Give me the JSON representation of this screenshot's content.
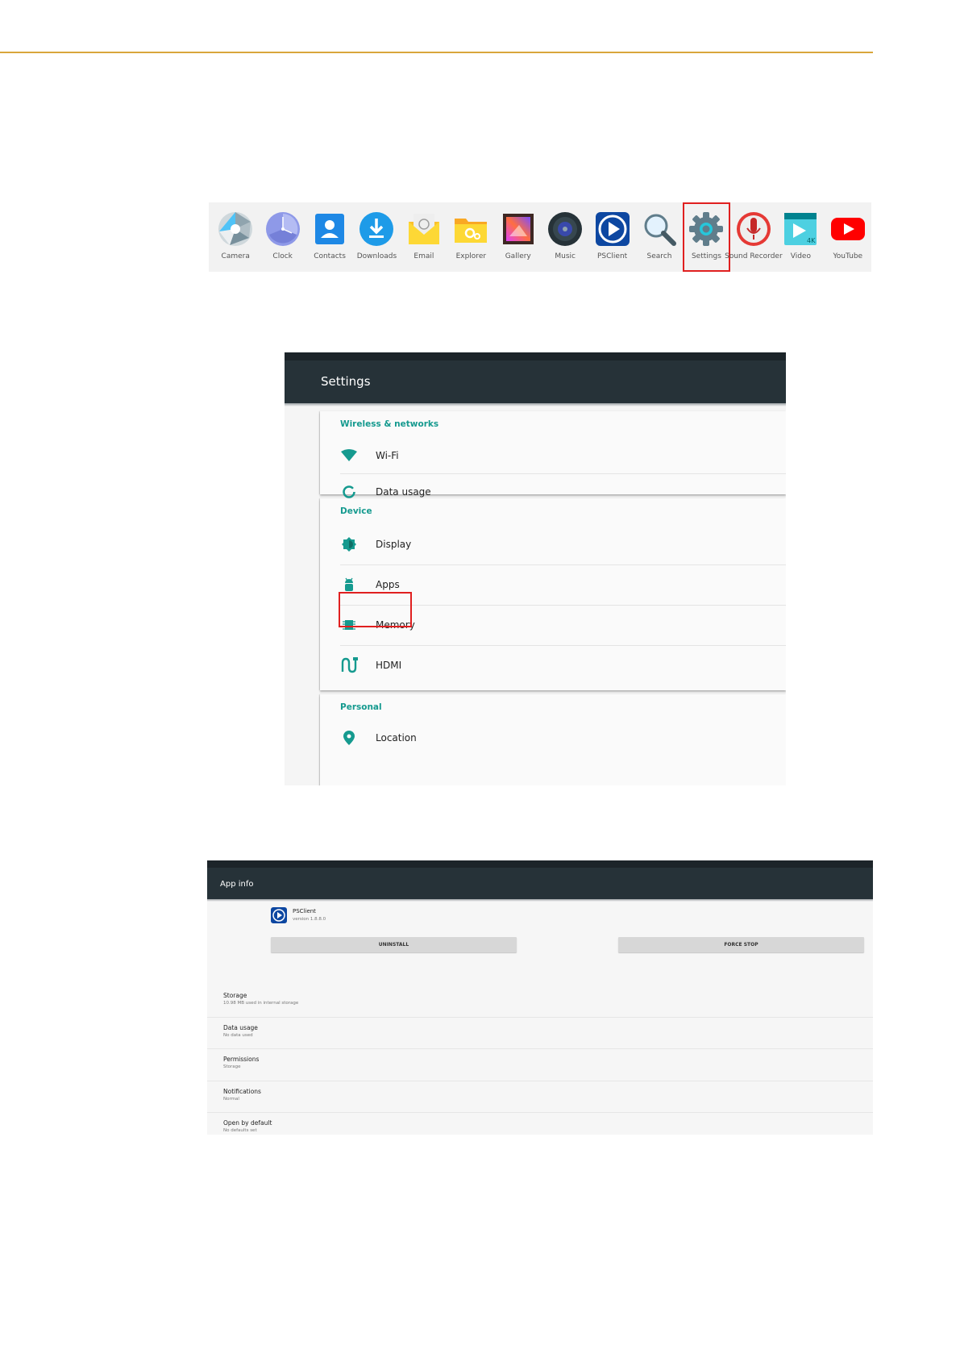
{
  "launcher": {
    "apps": [
      {
        "label": "Camera",
        "icon": "camera-icon"
      },
      {
        "label": "Clock",
        "icon": "clock-icon"
      },
      {
        "label": "Contacts",
        "icon": "contacts-icon"
      },
      {
        "label": "Downloads",
        "icon": "downloads-icon"
      },
      {
        "label": "Email",
        "icon": "email-icon"
      },
      {
        "label": "Explorer",
        "icon": "explorer-icon"
      },
      {
        "label": "Gallery",
        "icon": "gallery-icon"
      },
      {
        "label": "Music",
        "icon": "music-icon"
      },
      {
        "label": "PSClient",
        "icon": "psclient-icon"
      },
      {
        "label": "Search",
        "icon": "search-icon"
      },
      {
        "label": "Settings",
        "icon": "gear-icon",
        "highlighted": true
      },
      {
        "label": "Sound Recorder",
        "icon": "microphone-icon"
      },
      {
        "label": "Video",
        "icon": "video-icon"
      },
      {
        "label": "YouTube",
        "icon": "youtube-icon"
      }
    ]
  },
  "settings": {
    "title": "Settings",
    "sections": [
      {
        "header": "Wireless & networks",
        "items": [
          {
            "label": "Wi-Fi",
            "icon": "wifi-icon"
          },
          {
            "label": "Data usage",
            "icon": "data-usage-icon"
          }
        ]
      },
      {
        "header": "Device",
        "items": [
          {
            "label": "Display",
            "icon": "display-brightness-icon"
          },
          {
            "label": "Apps",
            "icon": "android-icon",
            "highlighted": true
          },
          {
            "label": "Memory",
            "icon": "memory-chip-icon"
          },
          {
            "label": "HDMI",
            "icon": "hdmi-cable-icon"
          }
        ]
      },
      {
        "header": "Personal",
        "items": [
          {
            "label": "Location",
            "icon": "location-pin-icon"
          }
        ]
      }
    ]
  },
  "app_info": {
    "title": "App info",
    "app_name": "PSClient",
    "app_version": "version 1.8.8.0",
    "uninstall_label": "UNINSTALL",
    "force_stop_label": "FORCE STOP",
    "rows": [
      {
        "title": "Storage",
        "subtitle": "10.98 MB used in internal storage"
      },
      {
        "title": "Data usage",
        "subtitle": "No data used"
      },
      {
        "title": "Permissions",
        "subtitle": "Storage"
      },
      {
        "title": "Notifications",
        "subtitle": "Normal"
      },
      {
        "title": "Open by default",
        "subtitle": "No defaults set"
      }
    ]
  },
  "colors": {
    "accent": "#159a8f",
    "toolbar": "#263238",
    "highlight": "#e02020",
    "header_rule": "#d9a63b"
  }
}
